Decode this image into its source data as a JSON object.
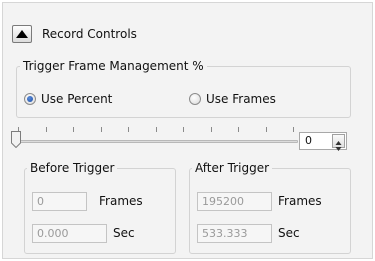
{
  "section": {
    "title": "Record Controls",
    "expanded": true
  },
  "trigger_frame_group": {
    "title": "Trigger Frame Management %",
    "options": [
      {
        "label": "Use Percent",
        "checked": true
      },
      {
        "label": "Use Frames",
        "checked": false
      }
    ]
  },
  "slider": {
    "value": "0",
    "position_fraction": 0.0
  },
  "before_trigger": {
    "title": "Before Trigger",
    "frames_value": "0",
    "frames_label": "Frames",
    "sec_value": "0.000",
    "sec_label": "Sec"
  },
  "after_trigger": {
    "title": "After Trigger",
    "frames_value": "195200",
    "frames_label": "Frames",
    "sec_value": "533.333",
    "sec_label": "Sec"
  },
  "icons": {
    "collapse": "triangle-up-icon",
    "spin_up": "chevron-up-icon",
    "spin_down": "chevron-down-icon"
  },
  "colors": {
    "radio_selected": "#1c4fa8",
    "panel_background": "#f3f3f3",
    "disabled_text": "#9a9a9a"
  }
}
